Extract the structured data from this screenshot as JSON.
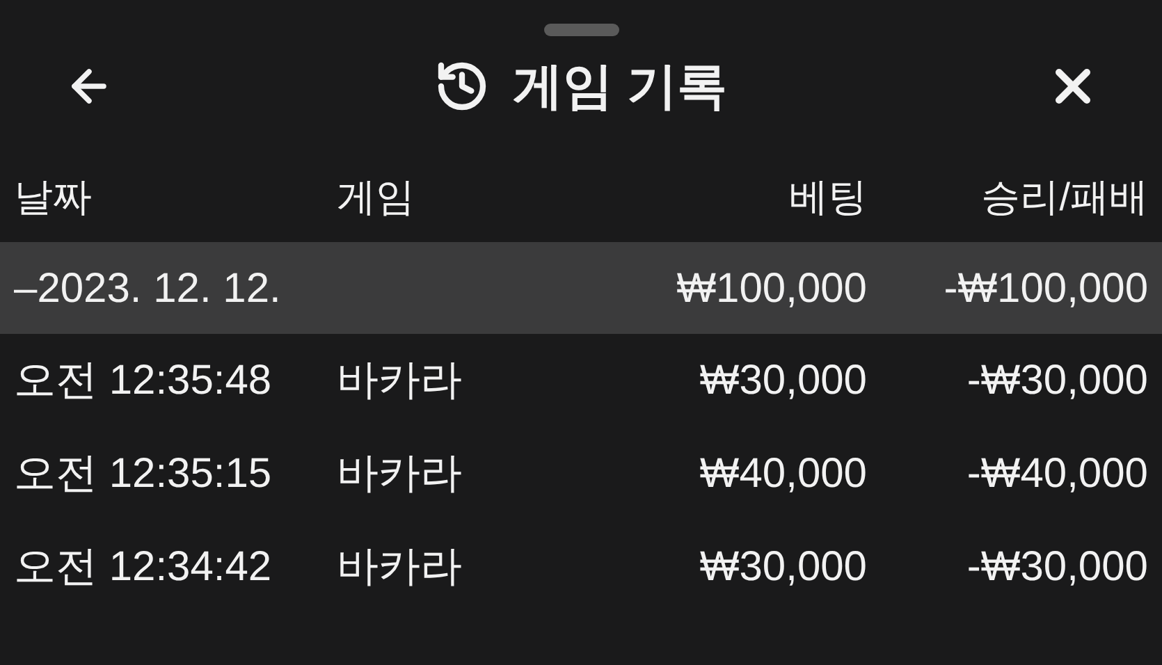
{
  "header": {
    "title": "게임 기록"
  },
  "table": {
    "columns": [
      "날짜",
      "게임",
      "베팅",
      "승리/패배"
    ],
    "groups": [
      {
        "toggle": "–",
        "date": "2023. 12. 12.",
        "bet": "₩100,000",
        "result": "-₩100,000",
        "expanded": true,
        "rows": [
          {
            "time": "오전 12:35:48",
            "game": "바카라",
            "bet": "₩30,000",
            "result": "-₩30,000"
          },
          {
            "time": "오전 12:35:15",
            "game": "바카라",
            "bet": "₩40,000",
            "result": "-₩40,000"
          },
          {
            "time": "오전 12:34:42",
            "game": "바카라",
            "bet": "₩30,000",
            "result": "-₩30,000"
          }
        ]
      }
    ]
  }
}
